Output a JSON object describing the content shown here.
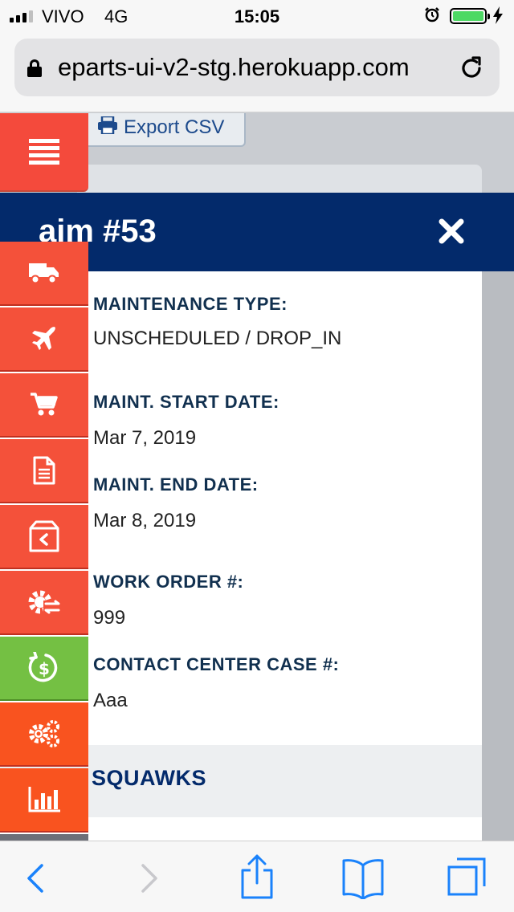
{
  "status_bar": {
    "carrier": "VIVO",
    "network": "4G",
    "time": "15:05",
    "battery_level": 1.0,
    "alarm_icon": "alarm-clock-icon",
    "charging_icon": "lightning-bolt-icon"
  },
  "browser": {
    "url": "eparts-ui-v2-stg.herokuapp.com"
  },
  "page": {
    "export_label": "Export CSV"
  },
  "modal": {
    "title": "aim #53",
    "fields": [
      {
        "label": "MAINTENANCE TYPE:",
        "value": "UNSCHEDULED / DROP_IN"
      },
      {
        "label": "MAINT. START DATE:",
        "value": "Mar 7, 2019"
      },
      {
        "label": "MAINT. END DATE:",
        "value": "Mar 8, 2019"
      },
      {
        "label": "WORK ORDER #:",
        "value": "999"
      },
      {
        "label": "CONTACT CENTER CASE #:",
        "value": "Aaa"
      }
    ],
    "section_title": "SQUAWKS"
  },
  "sidebar": {
    "items": [
      {
        "icon": "menu-icon"
      },
      {
        "icon": "truck-icon"
      },
      {
        "icon": "airplane-icon"
      },
      {
        "icon": "cart-icon"
      },
      {
        "icon": "document-icon"
      },
      {
        "icon": "return-box-icon"
      },
      {
        "icon": "gear-exchange-icon"
      },
      {
        "icon": "dollar-refund-icon"
      },
      {
        "icon": "gears-icon"
      },
      {
        "icon": "bar-chart-icon"
      }
    ]
  },
  "colors": {
    "header_navy": "#032a6b",
    "sidebar_red": "#f4513a",
    "sidebar_green": "#74c043",
    "sidebar_orange": "#f9531f",
    "ios_blue": "#1a82fb"
  }
}
